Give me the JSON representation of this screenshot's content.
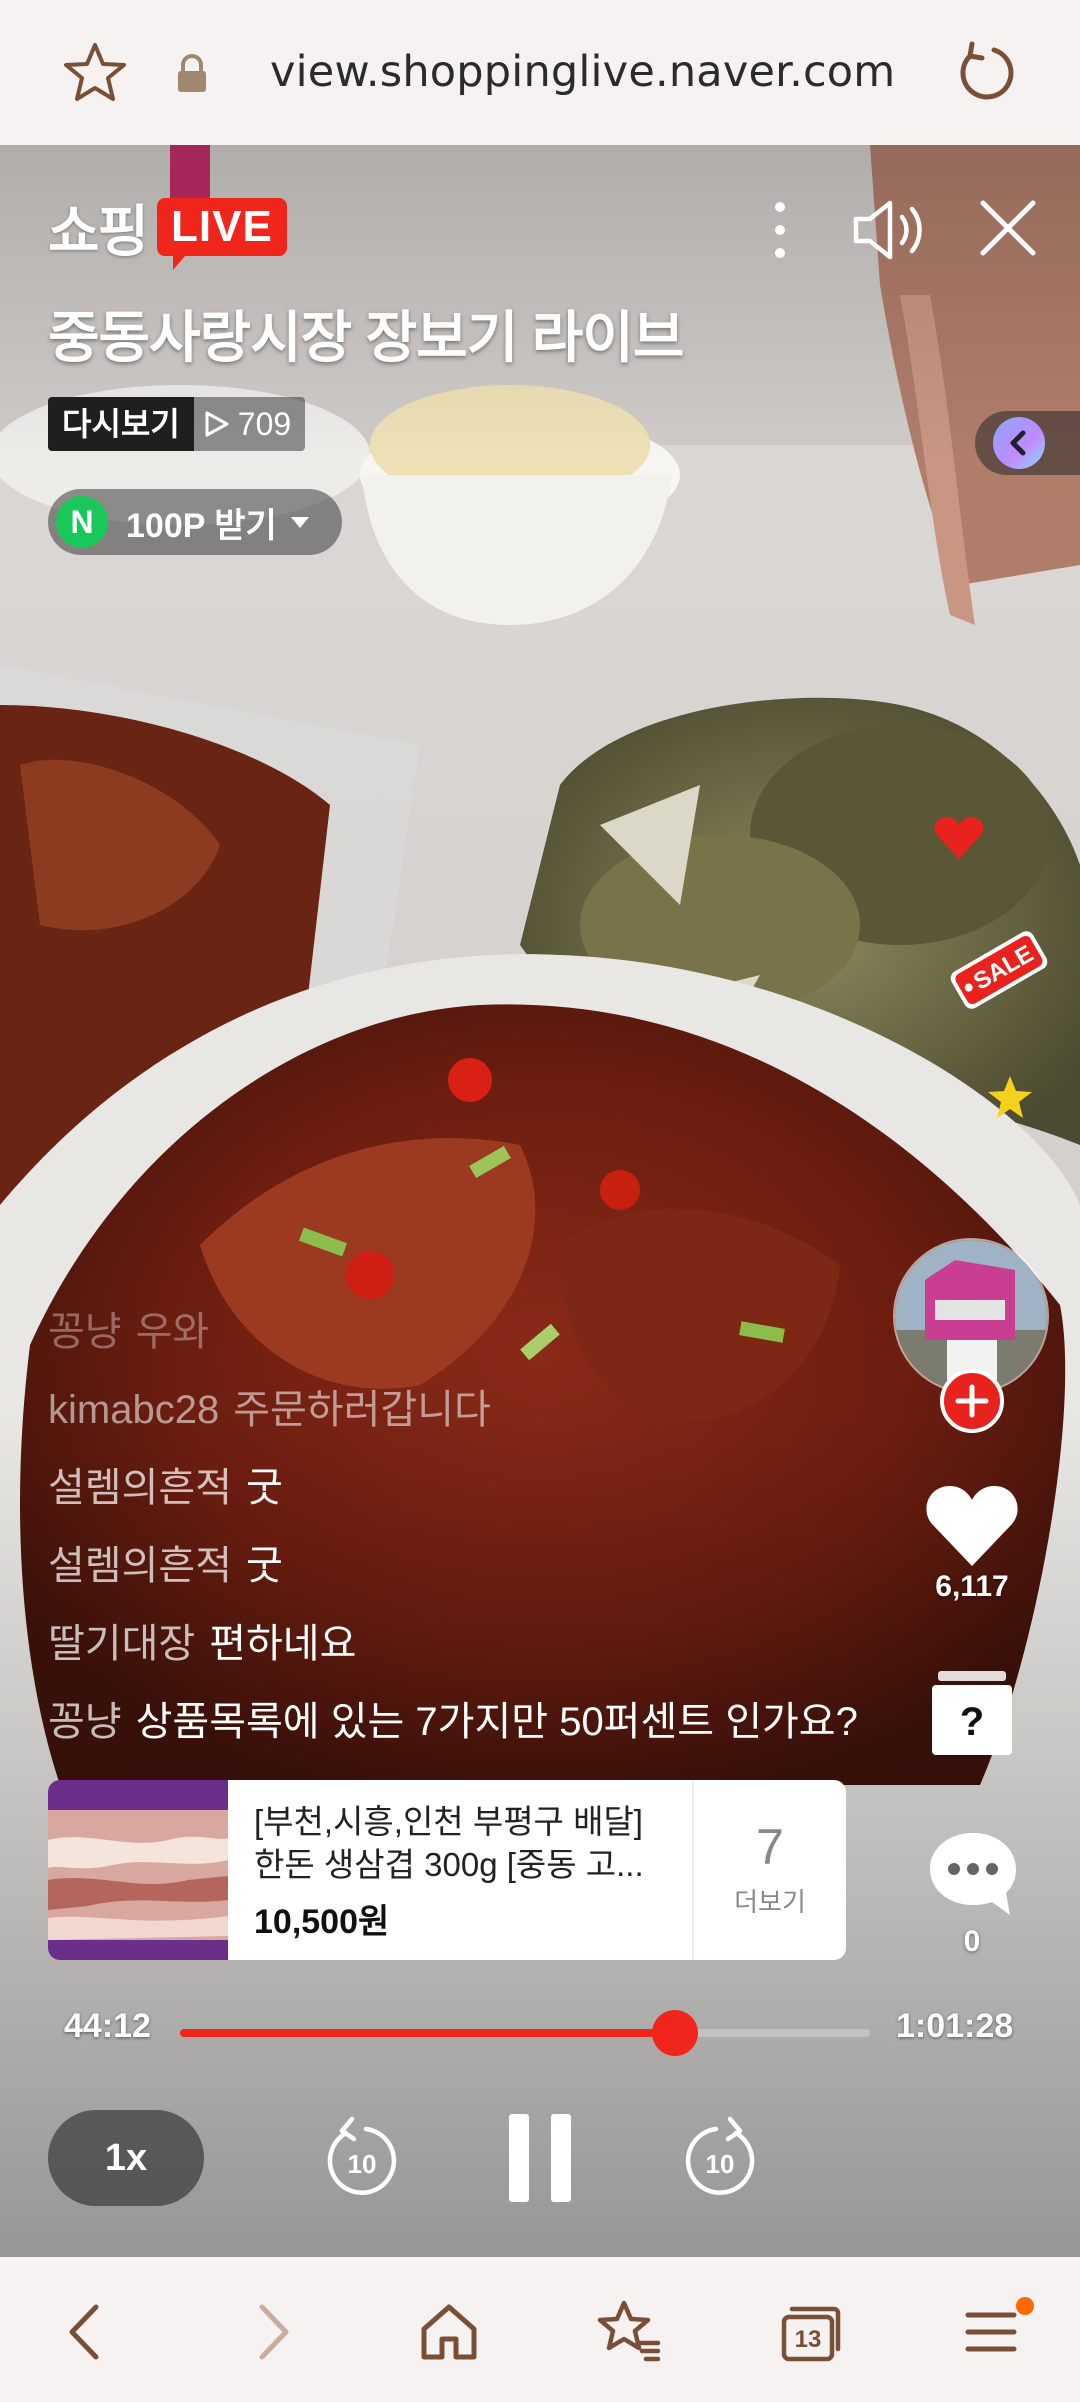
{
  "browser": {
    "url": "view.shoppinglive.naver.com"
  },
  "live": {
    "logo_text": "쇼핑",
    "live_badge": "LIVE",
    "title": "중동사랑시장 장보기 라이브",
    "replay_badge": "다시보기",
    "view_count": "709",
    "point_button": "100P 받기",
    "point_icon_letter": "N",
    "sale_sticker": "SALE"
  },
  "chat": [
    {
      "user": "꽁냥",
      "message": "우와"
    },
    {
      "user": "kimabc28",
      "message": "주문하러갑니다"
    },
    {
      "user": "설렘의흔적",
      "message": "굿"
    },
    {
      "user": "설렘의흔적",
      "message": "굿"
    },
    {
      "user": "딸기대장",
      "message": "편하네요"
    },
    {
      "user": "꽁냥",
      "message": "상품목록에 있는 7가지만 50퍼센트 인가요?"
    }
  ],
  "product": {
    "name": "[부천,시흥,인천 부평구 배달] 한돈 생삼겹 300g [중동 고...",
    "price": "10,500원",
    "more_count": "7",
    "more_label": "더보기"
  },
  "side": {
    "like_count": "6,117",
    "quiz_label": "?",
    "comment_count": "0"
  },
  "player": {
    "current_time": "44:12",
    "total_time": "1:01:28",
    "progress": 0.7175,
    "speed": "1x",
    "skip_back_seconds": "10",
    "skip_forward_seconds": "10"
  },
  "bottom_nav": {
    "tab_count": "13"
  },
  "colors": {
    "accent_red": "#f0251c",
    "naver_green": "#19c85a",
    "toolbar_icon": "#7a4f36"
  }
}
